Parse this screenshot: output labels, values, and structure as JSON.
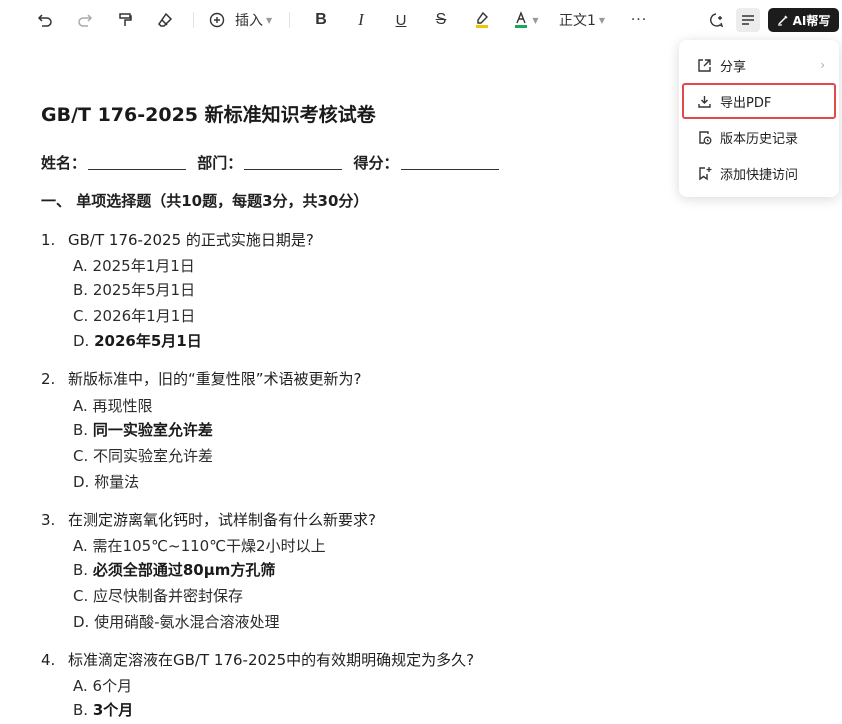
{
  "toolbar": {
    "insert_label": "插入",
    "paragraph_style": "正文1",
    "ai_label": "AI帮写"
  },
  "document": {
    "title": "GB/T 176-2025 新标准知识考核试卷",
    "info": {
      "name_label": "姓名：",
      "dept_label": "部门：",
      "score_label": "得分："
    },
    "section": "一、 单项选择题（共10题，每题3分，共30分）",
    "questions": [
      {
        "num": "1.",
        "text": "GB/T 176-2025 的正式实施日期是?",
        "options": [
          "A. 2025年1月1日",
          "B. 2025年5月1日",
          "C. 2026年1月1日"
        ],
        "answer_prefix": "D. ",
        "answer": "2026年5月1日"
      },
      {
        "num": "2.",
        "text": "新版标准中，旧的“重复性限”术语被更新为?",
        "options": [
          "A. 再现性限",
          "C. 不同实验室允许差",
          "D. 称量法"
        ],
        "answer_prefix": "B. ",
        "answer": "同一实验室允许差"
      },
      {
        "num": "3.",
        "text": "在测定游离氧化钙时，试样制备有什么新要求?",
        "options": [
          "A. 需在105℃~110℃干燥2小时以上",
          "C. 应尽快制备并密封保存",
          "D. 使用硝酸-氨水混合溶液处理"
        ],
        "answer_prefix": "B. ",
        "answer": "必须全部通过80μm方孔筛"
      },
      {
        "num": "4.",
        "text": "标准滴定溶液在GB/T 176-2025中的有效期明确规定为多久?",
        "options": [
          "A. 6个月"
        ],
        "answer_prefix": "B. ",
        "answer": "3个月"
      }
    ]
  },
  "menu": {
    "items": [
      {
        "label": "分享",
        "icon": "share-icon"
      },
      {
        "label": "导出PDF",
        "icon": "download-icon"
      },
      {
        "label": "版本历史记录",
        "icon": "history-icon"
      },
      {
        "label": "添加快捷访问",
        "icon": "bookmark-add-icon"
      }
    ]
  },
  "colors": {
    "highlight_border": "#e04a4a",
    "ai_button_bg": "#1c1c1c"
  }
}
